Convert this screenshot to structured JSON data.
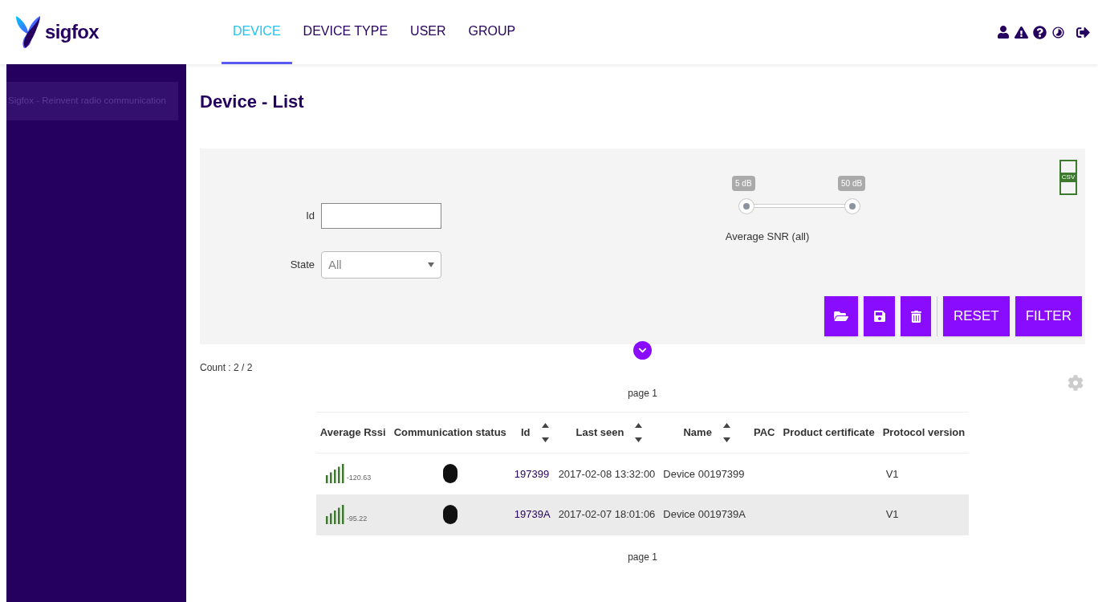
{
  "header": {
    "logo_text": "sigfox",
    "tabs": [
      {
        "label": "DEVICE",
        "selected": true
      },
      {
        "label": "DEVICE TYPE",
        "selected": false
      },
      {
        "label": "USER",
        "selected": false
      },
      {
        "label": "GROUP",
        "selected": false
      }
    ]
  },
  "sidebar": {
    "items": [
      "Sigfox - Reinvent radio communication"
    ]
  },
  "page_title": "Device - List",
  "filters": {
    "id": {
      "label": "Id"
    },
    "state": {
      "label": "State",
      "value": "All"
    },
    "snr": {
      "label": "Average SNR (all)",
      "thumbs": [
        {
          "label": "5 dB",
          "level": 0
        },
        {
          "label": "50 dB",
          "level": 1
        }
      ]
    },
    "csv_label": "CSV",
    "buttons": [
      "RESET",
      "FILTER"
    ]
  },
  "count": "Count : 2 / 2",
  "pager_top": "page 1",
  "table": {
    "columns": [
      {
        "label": "Average Rssi",
        "sortable": false
      },
      {
        "label": "Communication status",
        "sortable": false
      },
      {
        "label": "Id",
        "sortable": true
      },
      {
        "label": "Last seen",
        "sortable": true
      },
      {
        "label": "Name",
        "sortable": true
      },
      {
        "label": "PAC",
        "sortable": false
      },
      {
        "label": "Product certificate",
        "sortable": false
      },
      {
        "label": "Protocol version",
        "sortable": false
      }
    ],
    "rows": [
      {
        "rssi": "-120.63",
        "id": "197399",
        "last_seen": "2017-02-08 13:32:00",
        "name": "Device 00197399",
        "protocol": "V1"
      },
      {
        "rssi": "-95.22",
        "id": "19739A",
        "last_seen": "2017-02-07 18:01:06",
        "name": "Device 0019739A",
        "protocol": "V1"
      }
    ]
  },
  "pager_bottom": "page 1"
}
